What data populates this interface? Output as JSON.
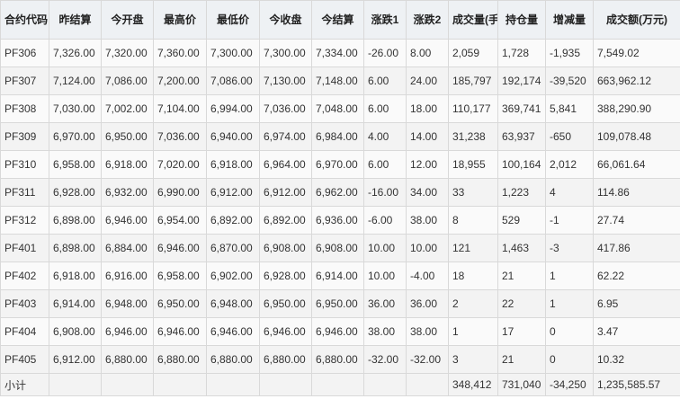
{
  "table": {
    "headers": [
      "合约代码",
      "昨结算",
      "今开盘",
      "最高价",
      "最低价",
      "今收盘",
      "今结算",
      "涨跌1",
      "涨跌2",
      "成交量(手)",
      "持仓量",
      "增减量",
      "成交额(万元)"
    ],
    "rows": [
      [
        "PF306",
        "7,326.00",
        "7,320.00",
        "7,360.00",
        "7,300.00",
        "7,300.00",
        "7,334.00",
        "-26.00",
        "8.00",
        "2,059",
        "1,728",
        "-1,935",
        "7,549.02"
      ],
      [
        "PF307",
        "7,124.00",
        "7,086.00",
        "7,200.00",
        "7,086.00",
        "7,130.00",
        "7,148.00",
        "6.00",
        "24.00",
        "185,797",
        "192,174",
        "-39,520",
        "663,962.12"
      ],
      [
        "PF308",
        "7,030.00",
        "7,002.00",
        "7,104.00",
        "6,994.00",
        "7,036.00",
        "7,048.00",
        "6.00",
        "18.00",
        "110,177",
        "369,741",
        "5,841",
        "388,290.90"
      ],
      [
        "PF309",
        "6,970.00",
        "6,950.00",
        "7,036.00",
        "6,940.00",
        "6,974.00",
        "6,984.00",
        "4.00",
        "14.00",
        "31,238",
        "63,937",
        "-650",
        "109,078.48"
      ],
      [
        "PF310",
        "6,958.00",
        "6,918.00",
        "7,020.00",
        "6,918.00",
        "6,964.00",
        "6,970.00",
        "6.00",
        "12.00",
        "18,955",
        "100,164",
        "2,012",
        "66,061.64"
      ],
      [
        "PF311",
        "6,928.00",
        "6,932.00",
        "6,990.00",
        "6,912.00",
        "6,912.00",
        "6,962.00",
        "-16.00",
        "34.00",
        "33",
        "1,223",
        "4",
        "114.86"
      ],
      [
        "PF312",
        "6,898.00",
        "6,946.00",
        "6,954.00",
        "6,892.00",
        "6,892.00",
        "6,936.00",
        "-6.00",
        "38.00",
        "8",
        "529",
        "-1",
        "27.74"
      ],
      [
        "PF401",
        "6,898.00",
        "6,884.00",
        "6,946.00",
        "6,870.00",
        "6,908.00",
        "6,908.00",
        "10.00",
        "10.00",
        "121",
        "1,463",
        "-3",
        "417.86"
      ],
      [
        "PF402",
        "6,918.00",
        "6,916.00",
        "6,958.00",
        "6,902.00",
        "6,928.00",
        "6,914.00",
        "10.00",
        "-4.00",
        "18",
        "21",
        "1",
        "62.22"
      ],
      [
        "PF403",
        "6,914.00",
        "6,948.00",
        "6,950.00",
        "6,948.00",
        "6,950.00",
        "6,950.00",
        "36.00",
        "36.00",
        "2",
        "22",
        "1",
        "6.95"
      ],
      [
        "PF404",
        "6,908.00",
        "6,946.00",
        "6,946.00",
        "6,946.00",
        "6,946.00",
        "6,946.00",
        "38.00",
        "38.00",
        "1",
        "17",
        "0",
        "3.47"
      ],
      [
        "PF405",
        "6,912.00",
        "6,880.00",
        "6,880.00",
        "6,880.00",
        "6,880.00",
        "6,880.00",
        "-32.00",
        "-32.00",
        "3",
        "21",
        "0",
        "10.32"
      ]
    ],
    "footer": [
      "小计",
      "",
      "",
      "",
      "",
      "",
      "",
      "",
      "",
      "348,412",
      "731,040",
      "-34,250",
      "1,235,585.57"
    ]
  }
}
